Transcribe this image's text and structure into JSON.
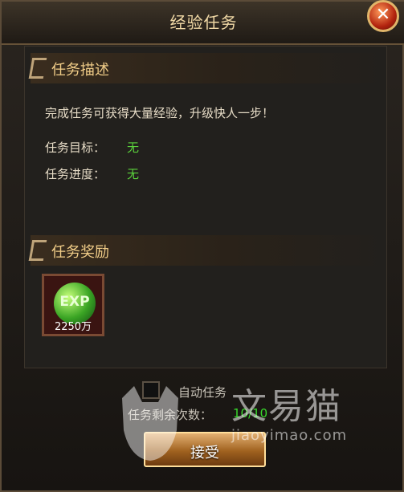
{
  "dialog": {
    "title": "经验任务"
  },
  "sections": {
    "description": {
      "header": "任务描述",
      "text": "完成任务可获得大量经验，升级快人一步！",
      "target_label": "任务目标：",
      "target_value": "无",
      "progress_label": "任务进度：",
      "progress_value": "无"
    },
    "reward": {
      "header": "任务奖励",
      "item_icon": "exp-orb-icon",
      "item_text": "EXP",
      "item_amount": "2250万"
    }
  },
  "footer": {
    "auto_task_label": "自动任务",
    "auto_task_checked": false,
    "remaining_label": "任务剩余次数：",
    "remaining_value": "10/10",
    "accept_label": "接受"
  },
  "watermark": {
    "text_cn": "文易猫",
    "text_en": "jiaoyimao.com"
  },
  "colors": {
    "value_green": "#5bd23c",
    "header_gold": "#f1cd88",
    "title": "#f0d8a5"
  }
}
